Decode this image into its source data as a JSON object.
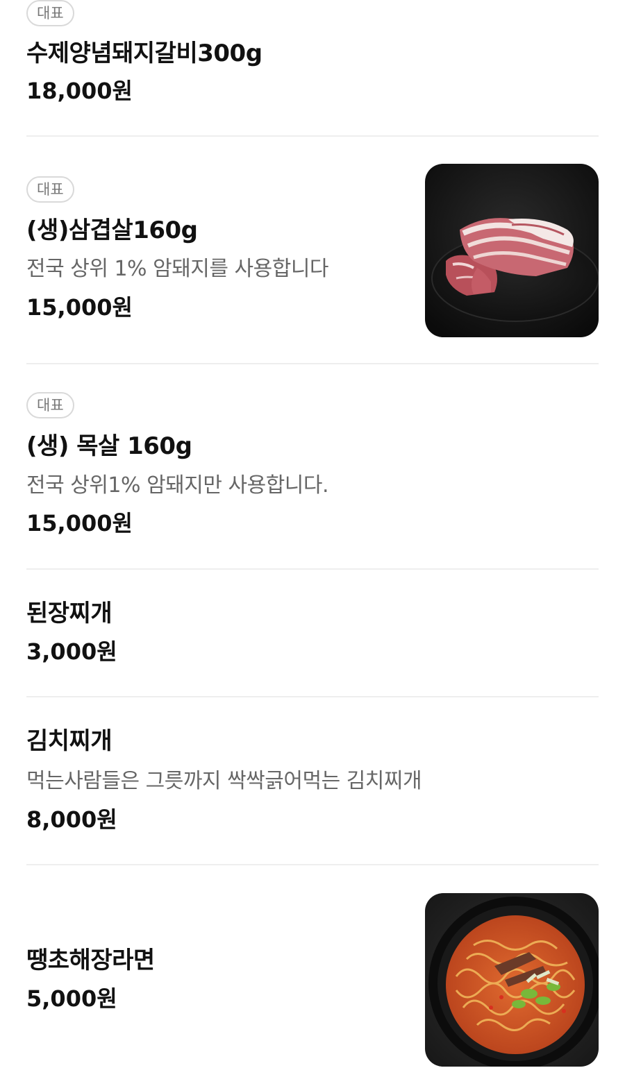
{
  "menu": {
    "items": [
      {
        "badge": "대표",
        "name": "수제양념돼지갈비300g",
        "price": "18,000원"
      },
      {
        "badge": "대표",
        "name": "(생)삼겹살160g",
        "description": "전국 상위 1% 암돼지를 사용합니다",
        "price": "15,000원",
        "image": "pork-belly-photo"
      },
      {
        "badge": "대표",
        "name": "(생) 목살 160g",
        "description": "전국 상위1% 암돼지만 사용합니다.",
        "price": "15,000원"
      },
      {
        "name": "된장찌개",
        "price": "3,000원"
      },
      {
        "name": "김치찌개",
        "description": "먹는사람들은 그릇까지 싹싹긁어먹는 김치찌개",
        "price": "8,000원"
      },
      {
        "name": "땡초해장라면",
        "price": "5,000원",
        "image": "spicy-ramen-photo"
      }
    ]
  }
}
